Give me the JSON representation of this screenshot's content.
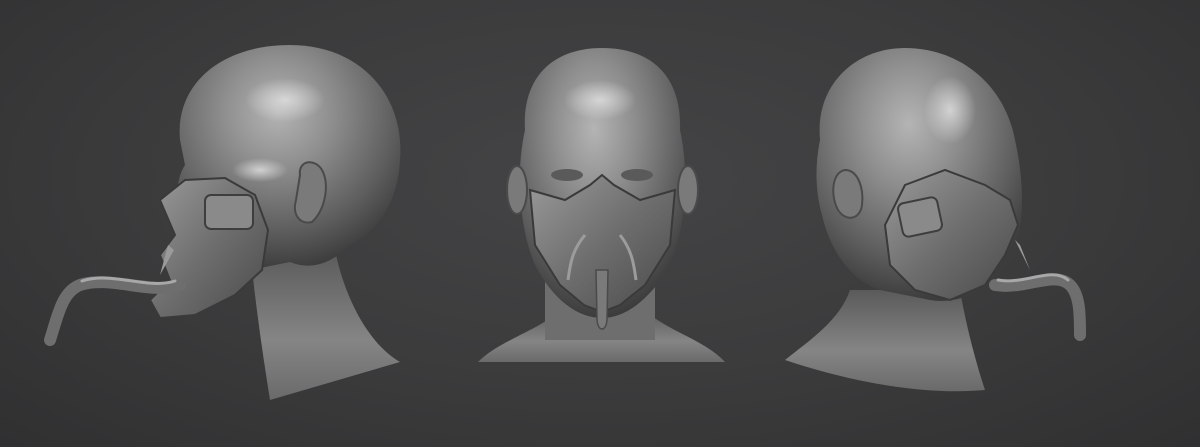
{
  "scene": {
    "background_color": "#3a3a3b",
    "clay_color": "#8c8c8c",
    "views": [
      {
        "name": "left-profile",
        "facing": "left"
      },
      {
        "name": "front",
        "facing": "front"
      },
      {
        "name": "right-three-quarter",
        "facing": "right"
      }
    ]
  }
}
